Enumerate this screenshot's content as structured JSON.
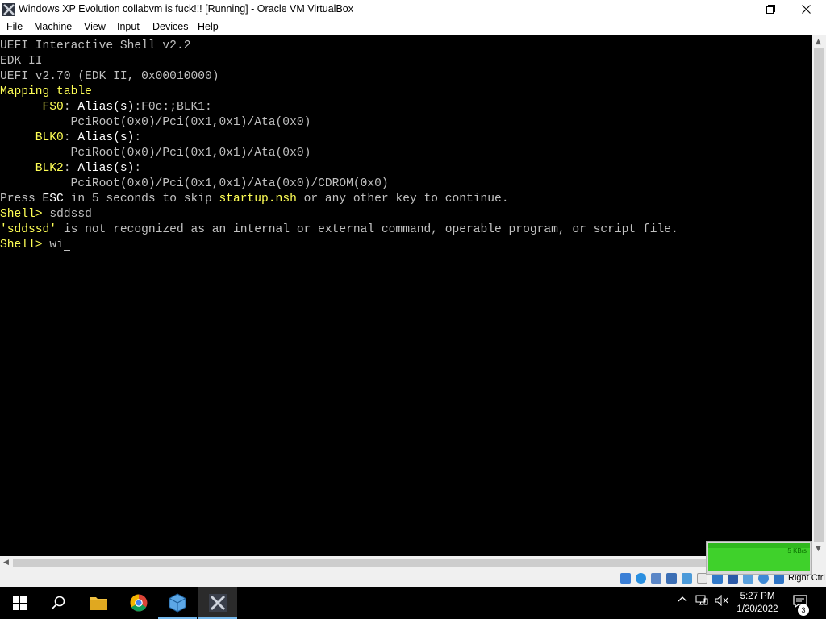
{
  "window": {
    "title": "Windows XP Evolution collabvm is fuck!!! [Running] - Oracle VM VirtualBox",
    "app_icon": "virtualbox-x-icon",
    "controls": [
      "minimize-icon",
      "maximize-icon",
      "close-icon"
    ]
  },
  "menu": {
    "items": [
      "File",
      "Machine",
      "View",
      "Input",
      "Devices",
      "Help"
    ]
  },
  "console": {
    "l1": "UEFI Interactive Shell v2.2",
    "l2": "EDK II",
    "l3": "UEFI v2.70 (EDK II, 0x00010000)",
    "l4": "Mapping table",
    "l5a": "      FS0",
    "l5b": ": ",
    "l5c": "Alias(s)",
    "l5d": ":F0c:;BLK1:",
    "l6": "          PciRoot(0x0)/Pci(0x1,0x1)/Ata(0x0)",
    "l7a": "     BLK0",
    "l7b": ": ",
    "l7c": "Alias(s)",
    "l7d": ":",
    "l8": "          PciRoot(0x0)/Pci(0x1,0x1)/Ata(0x0)",
    "l9a": "     BLK2",
    "l9b": ": ",
    "l9c": "Alias(s)",
    "l9d": ":",
    "l10": "          PciRoot(0x0)/Pci(0x1,0x1)/Ata(0x0)/CDROM(0x0)",
    "l11a": "Press ",
    "l11b": "ESC",
    "l11c": " in 5 seconds to skip ",
    "l11d": "startup.nsh",
    "l11e": " or any other key to continue.",
    "l12a": "Shell> ",
    "l12b": "sddssd",
    "l13a": "'sddssd'",
    "l13b": " is not recognized as an internal or external command, operable program, or script file.",
    "l14a": "Shell> ",
    "l14b": "wi"
  },
  "statusbar": {
    "host_key": "Right Ctrl",
    "icons": [
      "hard-disk-icon",
      "optical-disk-icon",
      "audio-icon",
      "network-icon",
      "usb-icon",
      "shared-folders-icon",
      "display-icon",
      "recording-icon",
      "cpu-icon",
      "mouse-integration-icon",
      "keyboard-icon"
    ]
  },
  "net_widget": {
    "label": "5 KB/s"
  },
  "taskbar": {
    "items": [
      "windows-start-icon",
      "search-icon",
      "file-explorer-icon",
      "chrome-icon",
      "virtualbox-icon",
      "virtualbox-vm-icon"
    ],
    "time": "5:27 PM",
    "date": "1/20/2022",
    "notification_count": "3"
  },
  "colors": {
    "console_text": "#c0c0c0",
    "console_highlight": "#ffff55",
    "console_white": "#ffffff"
  }
}
